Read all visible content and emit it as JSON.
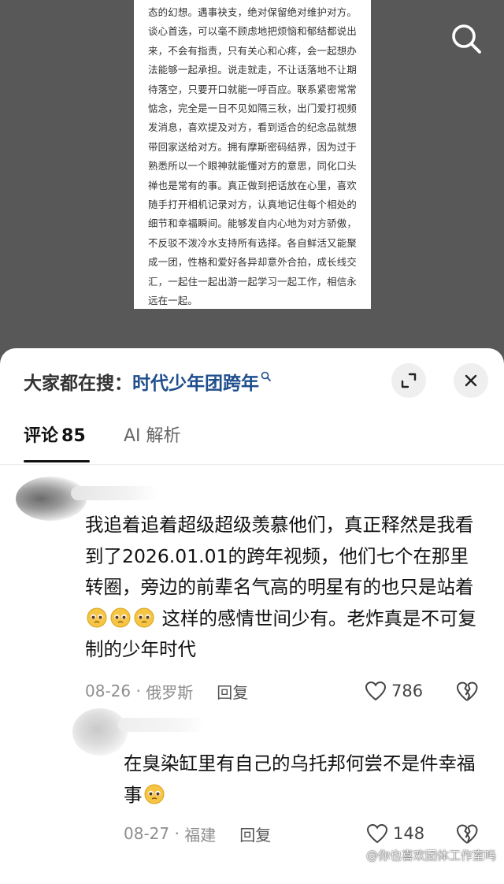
{
  "background_doc": {
    "text": "态的幻想。遇事袂支，绝对保留绝对维护对方。谈心首选，可以毫不顾虑地把烦恼和郁结都说出来，不会有指责，只有关心和心疼，会一起想办法能够一起承担。说走就走，不让话落地不让期待落空，只要开口就能一呼百应。联系紧密常常惦念，完全是一日不见如隔三秋，出门爱打视频发消息，喜欢提及对方，看到适合的纪念品就想带回家送给对方。拥有摩斯密码结界，因为过于熟悉所以一个眼神就能懂对方的意思，同化口头禅也是常有的事。真正做到把话放在心里，喜欢随手打开相机记录对方，认真地记住每个相处的细节和幸福瞬间。能够发自内心地为对方骄傲，不反驳不泼冷水支持所有选择。各自鲜活又能聚成一团，性格和爱好各异却意外合拍，成长线交汇，一起住一起出游一起学习一起工作，相信永远在一起。"
  },
  "header": {
    "hot_search_prefix": "大家都在搜：",
    "hot_search_keyword": "时代少年团跨年"
  },
  "tabs": {
    "comments_label": "评论",
    "comments_count": "85",
    "ai_label": "AI 解析"
  },
  "comments": [
    {
      "text_before": "我追着追着超级超级羡慕他们，真正释然是我看到了2026.01.01的跨年视频，他们七个在那里转圈，旁边的前辈名气高的明星有的也只是站着",
      "text_after": " 这样的感情世间少有。老炸真是不可复制的少年时代",
      "date": "08-26",
      "location": "俄罗斯",
      "reply_label": "回复",
      "likes": "786"
    },
    {
      "text_before": "在臭染缸里有自己的乌托邦何尝不是件幸福事",
      "date": "08-27",
      "location": "福建",
      "reply_label": "回复",
      "likes": "148"
    }
  ],
  "watermark": "@你也喜欢团体工作室吗",
  "colors": {
    "accent_keyword": "#1f4e8c",
    "dim_background": "#585858"
  }
}
